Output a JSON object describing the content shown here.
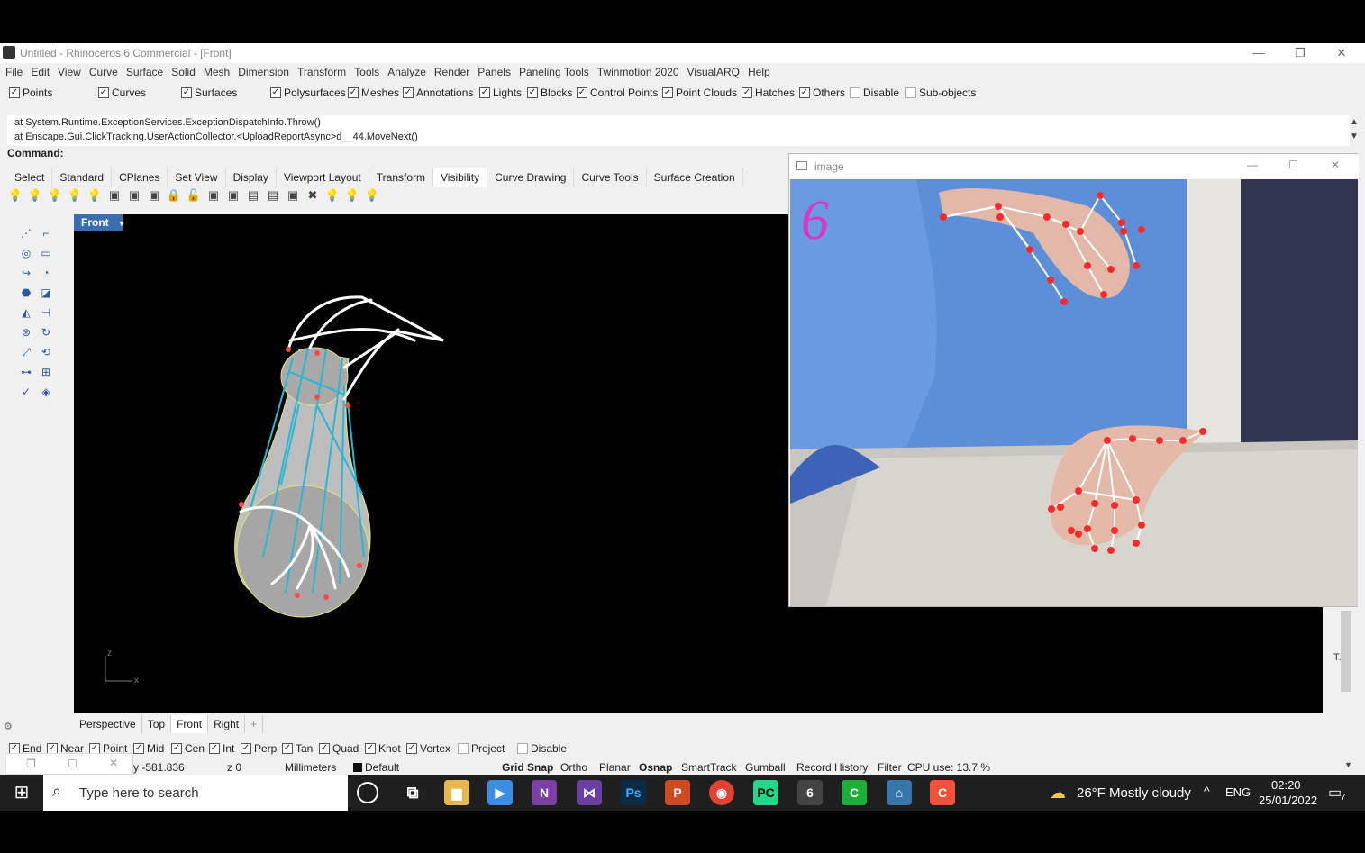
{
  "window": {
    "title": "Untitled - Rhinoceros 6 Commercial - [Front]",
    "controls": [
      "—",
      "❐",
      "✕"
    ]
  },
  "menu": [
    "File",
    "Edit",
    "View",
    "Curve",
    "Surface",
    "Solid",
    "Mesh",
    "Dimension",
    "Transform",
    "Tools",
    "Analyze",
    "Render",
    "Panels",
    "Paneling Tools",
    "Twinmotion 2020",
    "VisualARQ",
    "Help"
  ],
  "filters": [
    {
      "label": "Points",
      "checked": true
    },
    {
      "label": "Curves",
      "checked": true
    },
    {
      "label": "Surfaces",
      "checked": true
    },
    {
      "label": "Polysurfaces",
      "checked": true
    },
    {
      "label": "Meshes",
      "checked": true
    },
    {
      "label": "Annotations",
      "checked": true
    },
    {
      "label": "Lights",
      "checked": true
    },
    {
      "label": "Blocks",
      "checked": true
    },
    {
      "label": "Control Points",
      "checked": true
    },
    {
      "label": "Point Clouds",
      "checked": true
    },
    {
      "label": "Hatches",
      "checked": true
    },
    {
      "label": "Others",
      "checked": true
    },
    {
      "label": "Disable",
      "checked": false
    },
    {
      "label": "Sub-objects",
      "checked": false
    }
  ],
  "command_history": [
    "at System.Runtime.ExceptionServices.ExceptionDispatchInfo.Throw()",
    "at Enscape.Gui.ClickTracking.UserActionCollector.<UploadReportAsync>d__44.MoveNext()"
  ],
  "command_label": "Command:",
  "toolbar_tabs": [
    "Select",
    "Standard",
    "CPlanes",
    "Set View",
    "Display",
    "Viewport Layout",
    "Transform",
    "Visibility",
    "Curve Drawing",
    "Curve Tools",
    "Surface Creation"
  ],
  "active_tab": "Visibility",
  "viewport": {
    "label": "Front",
    "axis_z": "z",
    "axis_x": "x"
  },
  "viewport_tabs": [
    "Perspective",
    "Top",
    "Front",
    "Right"
  ],
  "osnaps": [
    {
      "label": "End",
      "checked": true
    },
    {
      "label": "Near",
      "checked": true
    },
    {
      "label": "Point",
      "checked": true
    },
    {
      "label": "Mid",
      "checked": true
    },
    {
      "label": "Cen",
      "checked": true
    },
    {
      "label": "Int",
      "checked": true
    },
    {
      "label": "Perp",
      "checked": true
    },
    {
      "label": "Tan",
      "checked": true
    },
    {
      "label": "Quad",
      "checked": true
    },
    {
      "label": "Knot",
      "checked": true
    },
    {
      "label": "Vertex",
      "checked": true
    },
    {
      "label": "Project",
      "checked": false
    },
    {
      "label": "Disable",
      "checked": false
    }
  ],
  "status": {
    "y": "y -581.836",
    "z": "z 0",
    "units": "Millimeters",
    "layer": "Default",
    "grid_snap": "Grid Snap",
    "ortho": "Ortho",
    "planar": "Planar",
    "osnap": "Osnap",
    "smarttrack": "SmartTrack",
    "gumball": "Gumball",
    "record_history": "Record History",
    "filter": "Filter",
    "cpu": "CPU use: 13.7 %"
  },
  "image_window": {
    "title": "image",
    "finger_count": "6",
    "controls": [
      "—",
      "☐",
      "✕"
    ]
  },
  "taskbar": {
    "search_placeholder": "Type here to search",
    "weather": "26°F  Mostly cloudy",
    "language": "ENG",
    "time": "02:20",
    "date": "25/01/2022",
    "notifications": "7"
  },
  "colors": {
    "accent": "#3a6eb0",
    "landmark": "#ff2a2a",
    "shirt": "#5b8fd6",
    "finger_count": "#d638c9"
  }
}
